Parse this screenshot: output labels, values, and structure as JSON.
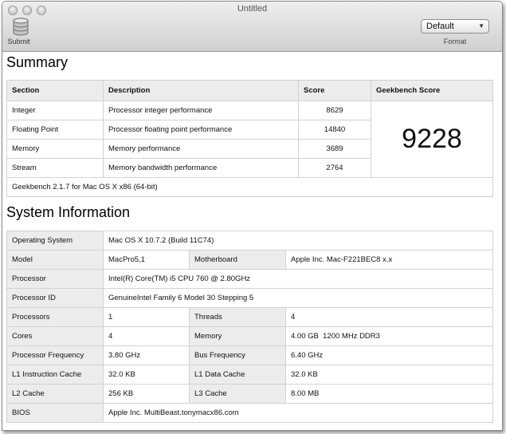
{
  "window": {
    "title": "Untitled"
  },
  "toolbar": {
    "submit_label": "Submit",
    "format_value": "Default",
    "format_label": "Format"
  },
  "summary": {
    "heading": "Summary",
    "columns": [
      "Section",
      "Description",
      "Score",
      "Geekbench Score"
    ],
    "rows": [
      {
        "section": "Integer",
        "description": "Processor integer performance",
        "score": "8629"
      },
      {
        "section": "Floating Point",
        "description": "Processor floating point performance",
        "score": "14840"
      },
      {
        "section": "Memory",
        "description": "Memory performance",
        "score": "3689"
      },
      {
        "section": "Stream",
        "description": "Memory bandwidth performance",
        "score": "2764"
      }
    ],
    "geekbench_score": "9228",
    "footer": "Geekbench 2.1.7 for Mac OS X x86 (64-bit)"
  },
  "system": {
    "heading": "System Information",
    "os_label": "Operating System",
    "os_value": "Mac OS X 10.7.2 (Build 11C74)",
    "model_label": "Model",
    "model_value": "MacPro5,1",
    "motherboard_label": "Motherboard",
    "motherboard_value": "Apple Inc. Mac-F221BEC8 x.x",
    "processor_label": "Processor",
    "processor_value": "Intel(R) Core(TM) i5 CPU 760 @ 2.80GHz",
    "processor_id_label": "Processor ID",
    "processor_id_value": "GenuineIntel Family 6 Model 30 Stepping 5",
    "processors_label": "Processors",
    "processors_value": "1",
    "threads_label": "Threads",
    "threads_value": "4",
    "cores_label": "Cores",
    "cores_value": "4",
    "memory_label": "Memory",
    "memory_value": "4.00 GB  1200 MHz DDR3",
    "proc_freq_label": "Processor Frequency",
    "proc_freq_value": "3.80 GHz",
    "bus_freq_label": "Bus Frequency",
    "bus_freq_value": "6.40 GHz",
    "l1i_label": "L1 Instruction Cache",
    "l1i_value": "32.0 KB",
    "l1d_label": "L1 Data Cache",
    "l1d_value": "32.0 KB",
    "l2_label": "L2 Cache",
    "l2_value": "256 KB",
    "l3_label": "L3 Cache",
    "l3_value": "8.00 MB",
    "bios_label": "BIOS",
    "bios_value": "Apple Inc. MultiBeast.tonymacx86.com"
  }
}
